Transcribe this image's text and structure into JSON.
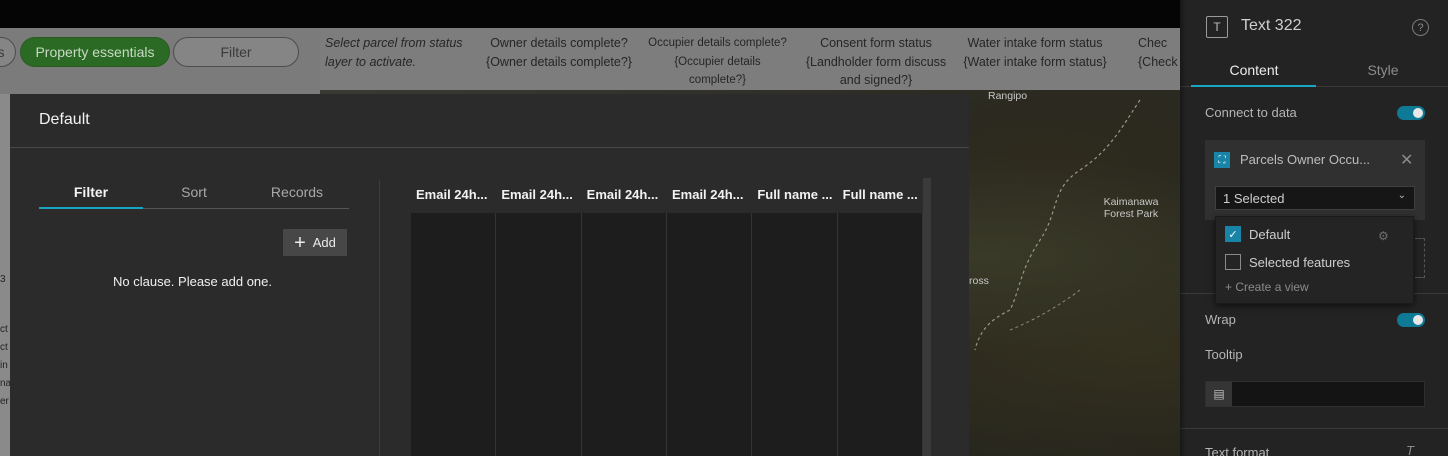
{
  "background": {
    "pills": [
      "s",
      "Property essentials",
      "Filter"
    ],
    "status_columns": [
      {
        "text": "Select parcel from status layer to activate.",
        "italic": true
      },
      {
        "text": "Owner details complete? {Owner details complete?}"
      },
      {
        "text": "Occupier details complete? {Occupier details complete?}"
      },
      {
        "text": "Consent form status {Landholder form discuss and signed?}"
      },
      {
        "text": "Water intake form status {Water intake form status}"
      },
      {
        "text": "Chec {Check"
      }
    ],
    "map_labels": [
      "Rangipo",
      "Kaimanawa Forest Park",
      "ross"
    ],
    "left_strip_fragments": [
      "3",
      "ct",
      "ct",
      "in",
      "na",
      "er"
    ]
  },
  "modal": {
    "title": "Default",
    "tabs": [
      "Filter",
      "Sort",
      "Records"
    ],
    "active_tab": "Filter",
    "add_label": "Add",
    "empty_message": "No clause. Please add one.",
    "columns": [
      "Email 24h...",
      "Email 24h...",
      "Email 24h...",
      "Email 24h...",
      "Full name ...",
      "Full name ..."
    ],
    "row_count": 8
  },
  "panel": {
    "title": "Text 322",
    "tabs": [
      "Content",
      "Style"
    ],
    "active_tab": "Content",
    "connect_label": "Connect to data",
    "connect_on": true,
    "data_source": "Parcels Owner Occu...",
    "select_value": "1 Selected",
    "dropdown_options": [
      {
        "label": "Default",
        "checked": true
      },
      {
        "label": "Selected features",
        "checked": false
      }
    ],
    "create_view": "+ Create a view",
    "wrap_label": "Wrap",
    "wrap_on": true,
    "tooltip_label": "Tooltip",
    "text_format_label": "Text format",
    "icons": [
      "text-icon",
      "help-icon",
      "data-source-icon",
      "close-icon",
      "chevron-down-icon",
      "gear-icon",
      "document-icon",
      "text-format-icon"
    ]
  },
  "colors": {
    "accent": "#19a6c2",
    "toggle": "#0e7a96",
    "pill_active": "#2a6a24"
  }
}
